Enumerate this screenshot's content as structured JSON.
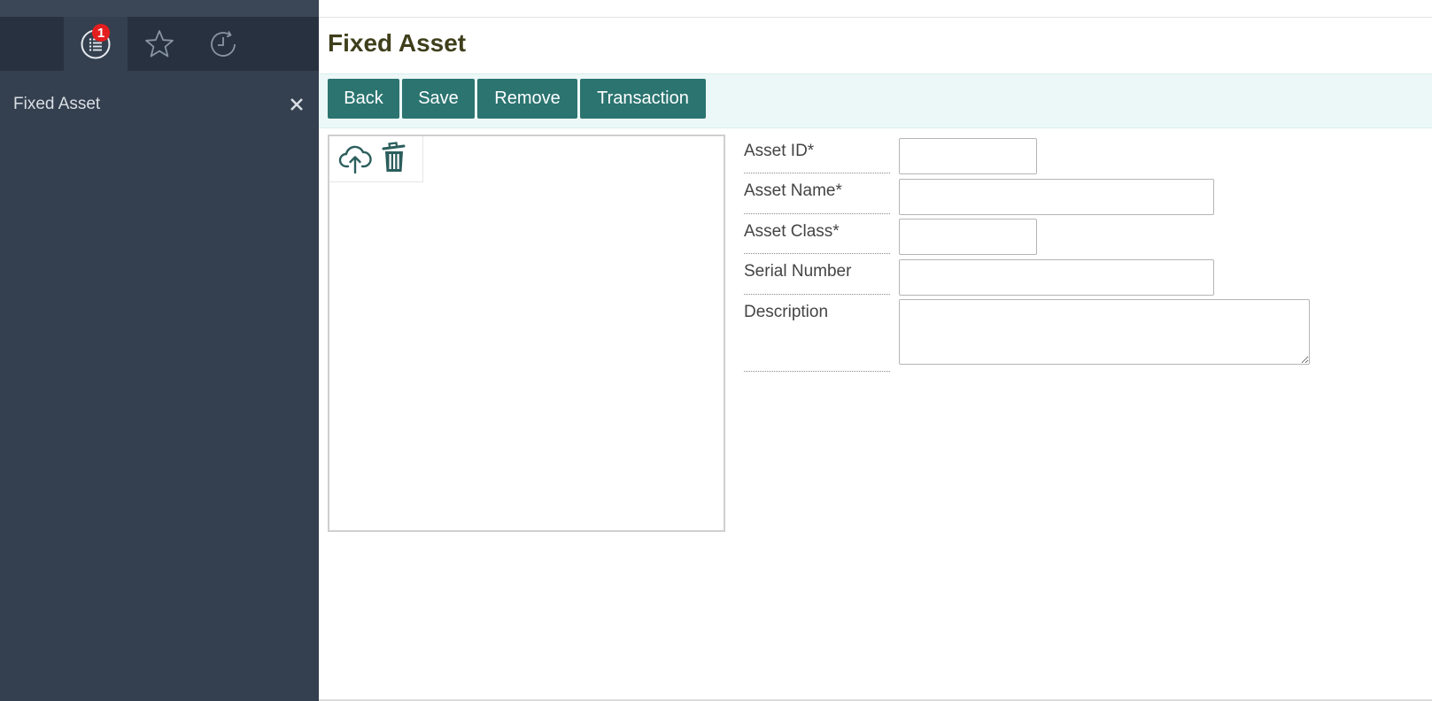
{
  "sidebar": {
    "tabs": [
      {
        "name": "list",
        "icon": "list-icon",
        "badge": "1",
        "active": true
      },
      {
        "name": "favorites",
        "icon": "star-icon",
        "active": false
      },
      {
        "name": "history",
        "icon": "history-icon",
        "active": false
      }
    ],
    "items": [
      {
        "label": "Fixed Asset",
        "close_icon": "close-icon"
      }
    ]
  },
  "page": {
    "title": "Fixed Asset"
  },
  "toolbar": {
    "back_label": "Back",
    "save_label": "Save",
    "remove_label": "Remove",
    "transaction_label": "Transaction"
  },
  "image_pane": {
    "upload_icon": "cloud-upload-icon",
    "delete_icon": "trash-icon"
  },
  "form": {
    "asset_id": {
      "label": "Asset ID*",
      "value": ""
    },
    "asset_name": {
      "label": "Asset Name*",
      "value": ""
    },
    "asset_class": {
      "label": "Asset Class*",
      "value": ""
    },
    "serial_number": {
      "label": "Serial Number",
      "value": ""
    },
    "description": {
      "label": "Description",
      "value": ""
    }
  },
  "colors": {
    "sidebar_bg": "#34404f",
    "tabbar_bg": "#273140",
    "accent": "#2b7470",
    "toolbar_bg": "#ecf8f7",
    "badge": "#e41e1e",
    "title": "#3f3f1c"
  }
}
